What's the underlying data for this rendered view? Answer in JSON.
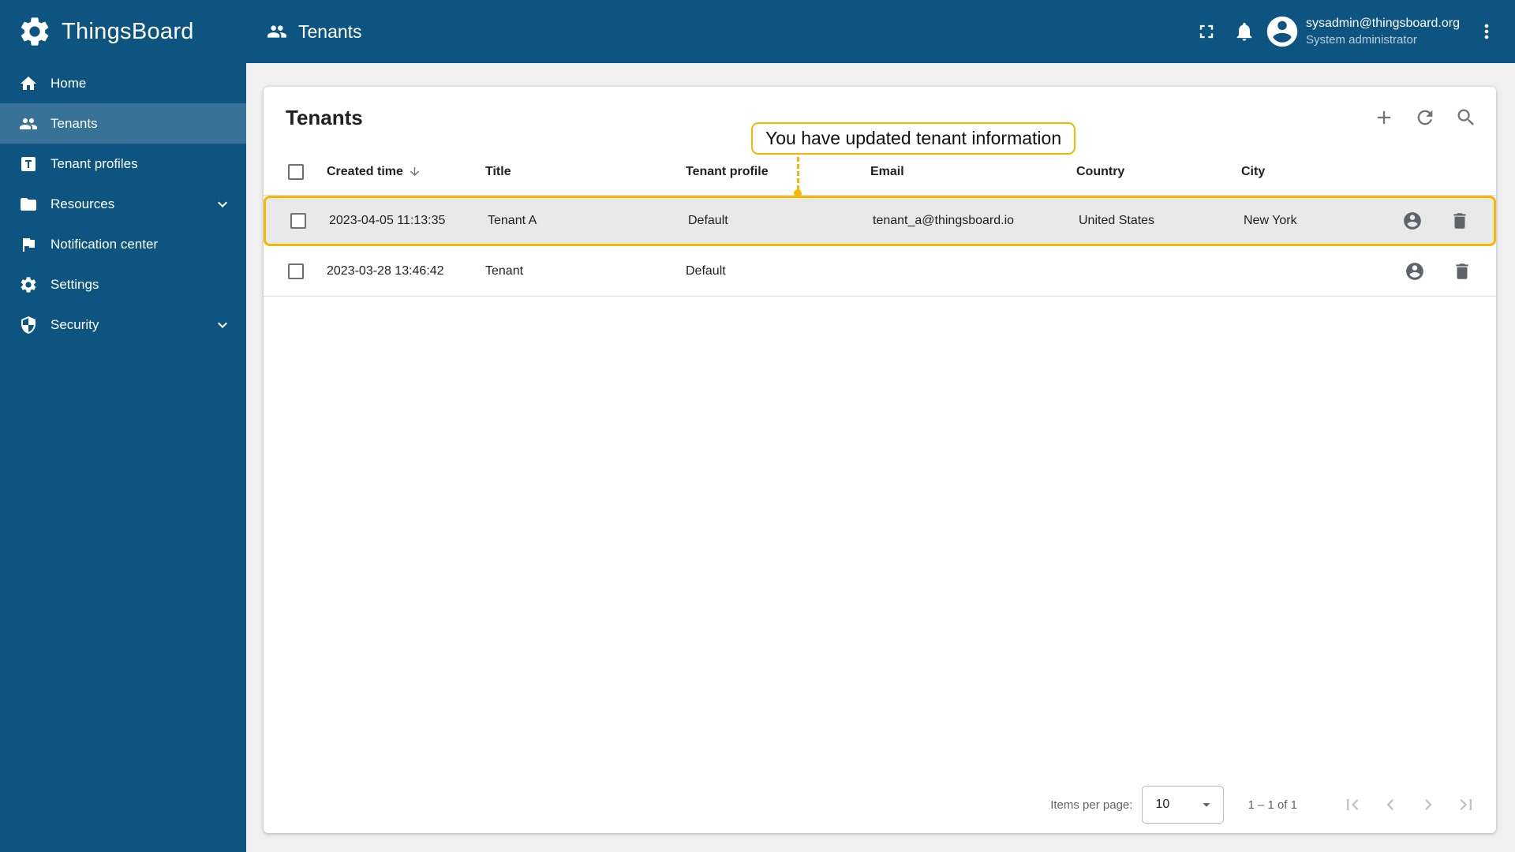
{
  "app": {
    "brand": "ThingsBoard",
    "page_title": "Tenants"
  },
  "topbar": {
    "user_email": "sysadmin@thingsboard.org",
    "user_role": "System administrator"
  },
  "sidebar": {
    "items": [
      {
        "label": "Home",
        "active": false
      },
      {
        "label": "Tenants",
        "active": true
      },
      {
        "label": "Tenant profiles",
        "active": false
      },
      {
        "label": "Resources",
        "active": false,
        "expandable": true
      },
      {
        "label": "Notification center",
        "active": false
      },
      {
        "label": "Settings",
        "active": false
      },
      {
        "label": "Security",
        "active": false,
        "expandable": true
      }
    ]
  },
  "callout": {
    "text": "You have updated tenant information"
  },
  "table": {
    "title": "Tenants",
    "columns": {
      "created_time": "Created time",
      "title": "Title",
      "tenant_profile": "Tenant profile",
      "email": "Email",
      "country": "Country",
      "city": "City"
    },
    "sorted_by": "created_time",
    "sort_direction": "desc",
    "rows": [
      {
        "created_time": "2023-04-05 11:13:35",
        "title": "Tenant A",
        "tenant_profile": "Default",
        "email": "tenant_a@thingsboard.io",
        "country": "United States",
        "city": "New York",
        "highlighted": true
      },
      {
        "created_time": "2023-03-28 13:46:42",
        "title": "Tenant",
        "tenant_profile": "Default",
        "email": "",
        "country": "",
        "city": "",
        "highlighted": false
      }
    ]
  },
  "pagination": {
    "items_per_page_label": "Items per page:",
    "items_per_page_value": "10",
    "range": "1 – 1 of 1"
  },
  "icons": {
    "brand": "gear-logo",
    "topbar": [
      "tenants-people",
      "fullscreen",
      "notifications-bell",
      "account-circle",
      "more-vert"
    ],
    "sidebar": [
      "home",
      "people",
      "tenant-profile-box",
      "folder",
      "flag",
      "gear",
      "shield",
      "chevron-down"
    ],
    "card_tools": [
      "add",
      "refresh",
      "search"
    ],
    "table": [
      "sort-arrow-down",
      "checkbox",
      "manage-user",
      "trash"
    ],
    "paginator": [
      "dropdown-arrow",
      "first-page",
      "chevron-left",
      "chevron-right",
      "last-page"
    ]
  },
  "colors": {
    "primary": "#0d5480",
    "sidebar_active": "rgba(255,255,255,0.18)",
    "highlight_yellow": "#f5b800",
    "row_highlight_bg": "#e9e9e9",
    "content_bg": "#f0f0f0"
  }
}
